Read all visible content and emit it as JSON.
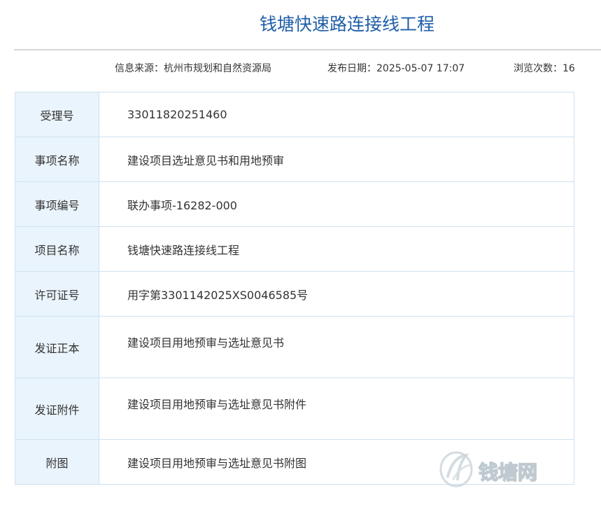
{
  "header": {
    "title": "钱塘快速路连接线工程"
  },
  "meta": {
    "source": "信息来源：杭州市规划和自然资源局",
    "date": "发布日期：2025-05-07 17:07",
    "views": "浏览次数：16"
  },
  "rows": [
    {
      "label": "受理号",
      "value": "33011820251460"
    },
    {
      "label": "事项名称",
      "value": "建设项目选址意见书和用地预审"
    },
    {
      "label": "事项编号",
      "value": "联办事项-16282-000"
    },
    {
      "label": "项目名称",
      "value": "钱塘快速路连接线工程"
    },
    {
      "label": "许可证号",
      "value": "用字第3301142025XS0046585号"
    },
    {
      "label": "发证正本",
      "value": "建设项目用地预审与选址意见书"
    },
    {
      "label": "发证附件",
      "value": "建设项目用地预审与选址意见书附件"
    },
    {
      "label": "附图",
      "value": "建设项目用地预审与选址意见书附图"
    }
  ],
  "watermark": {
    "text": "钱塘网"
  },
  "colors": {
    "title": "#1f5fa8",
    "label_bg": "#eaf4fc",
    "border": "#cfe1ef",
    "rule": "#d6d6d6"
  }
}
